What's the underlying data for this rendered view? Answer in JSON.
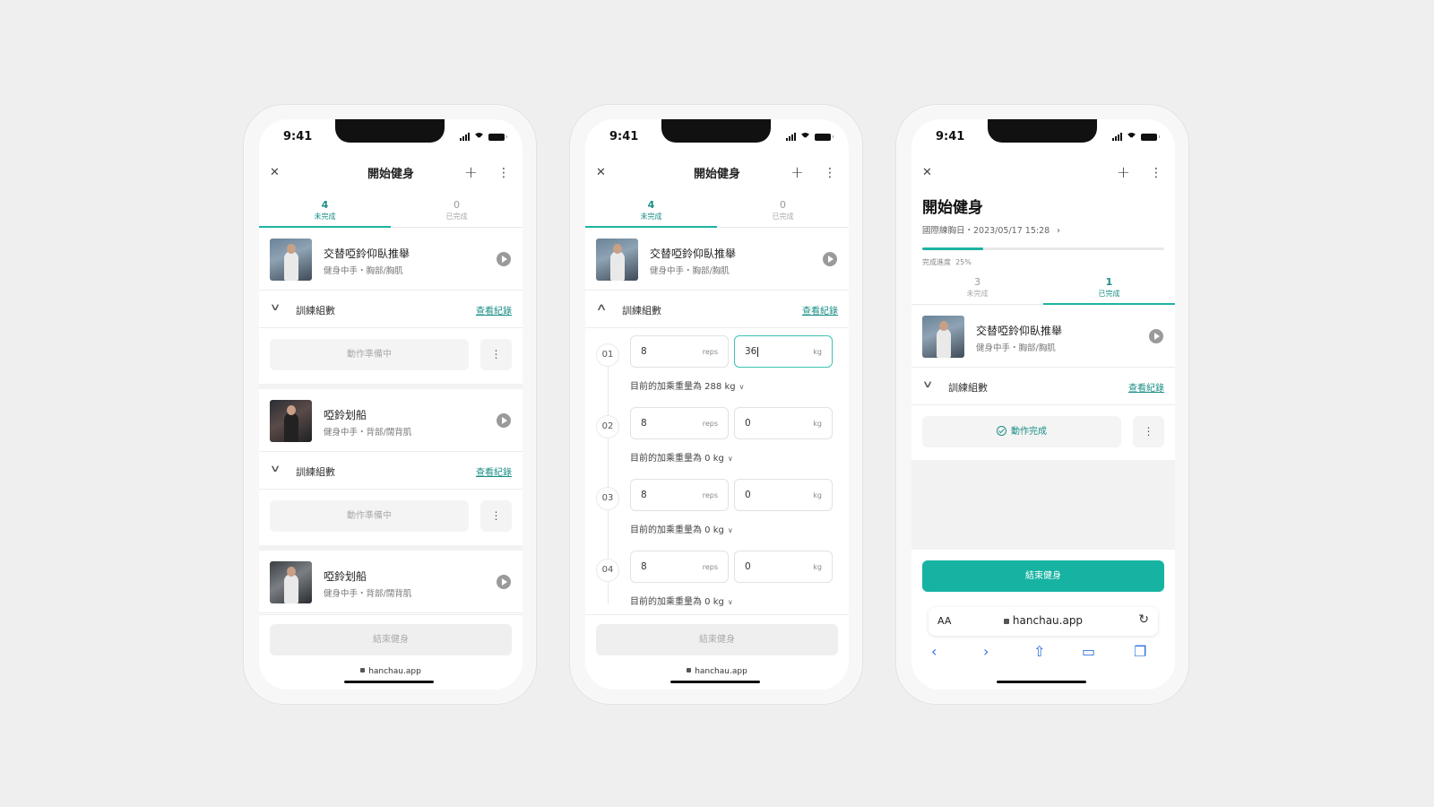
{
  "status": {
    "time": "9:41"
  },
  "app": {
    "title": "開始健身",
    "close_icon": "close-icon",
    "add_icon": "plus-icon",
    "more_icon": "more-vertical-icon"
  },
  "tabs": {
    "pending_count": "4",
    "pending_label": "未完成",
    "done_count": "0",
    "done_label": "已完成"
  },
  "sets_section": {
    "label": "訓練組數",
    "history_link": "查看紀錄"
  },
  "ready_label": "動作準備中",
  "more_glyph": "⋮",
  "end_label": "結束健身",
  "url": "hanchau.app",
  "exercises": [
    {
      "name": "交替啞鈴仰臥推舉",
      "sub": "健身中手・胸部/胸肌"
    },
    {
      "name": "啞鈴划船",
      "sub": "健身中手・背部/闊背肌"
    },
    {
      "name": "啞鈴划船",
      "sub": "健身中手・背部/闊背肌"
    }
  ],
  "sets": [
    {
      "no": "01",
      "reps": "8",
      "reps_unit": "reps",
      "weight": "36",
      "weight_unit": "kg",
      "hint": "目前的加乘重量為 288 kg"
    },
    {
      "no": "02",
      "reps": "8",
      "reps_unit": "reps",
      "weight": "0",
      "weight_unit": "kg",
      "hint": "目前的加乘重量為 0 kg"
    },
    {
      "no": "03",
      "reps": "8",
      "reps_unit": "reps",
      "weight": "0",
      "weight_unit": "kg",
      "hint": "目前的加乘重量為 0 kg"
    },
    {
      "no": "04",
      "reps": "8",
      "reps_unit": "reps",
      "weight": "0",
      "weight_unit": "kg",
      "hint": "目前的加乘重量為 0 kg"
    }
  ],
  "summary": {
    "meta": "國際練胸日・2023/05/17 15:28",
    "progress_label": "完成進度",
    "progress_value": "25%",
    "progress_fraction": 0.25,
    "pending_count": "3",
    "done_count": "1",
    "done_action": "動作完成"
  },
  "safari": {
    "aa": "AA",
    "host": "hanchau.app"
  },
  "colors": {
    "accent": "#17b3a2",
    "accent_text": "#1a8f85"
  }
}
